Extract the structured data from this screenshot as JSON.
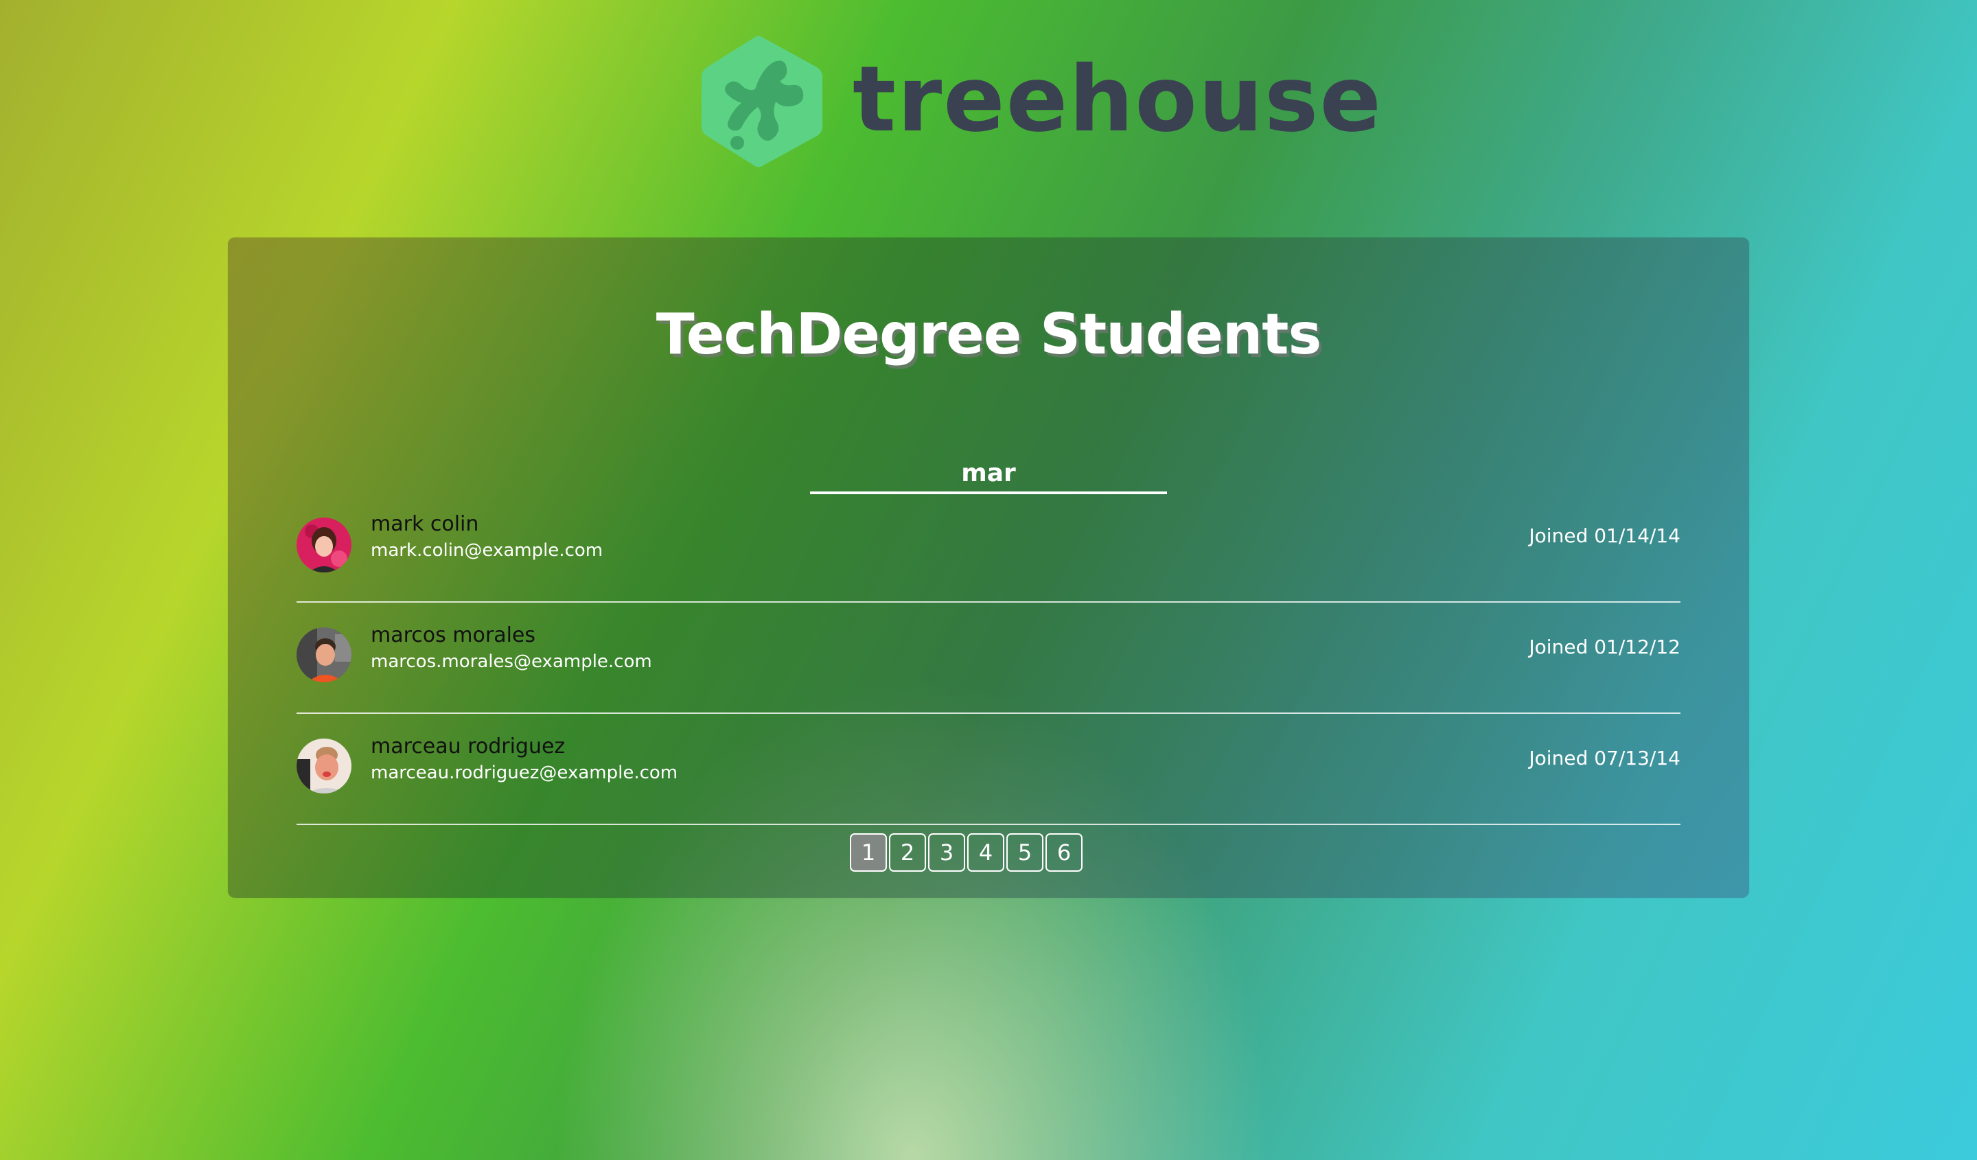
{
  "brand": {
    "logo_icon": "treehouse-logo-icon",
    "wordmark": "treehouse"
  },
  "page": {
    "title": "TechDegree Students"
  },
  "search": {
    "value": "mar",
    "placeholder": ""
  },
  "students": [
    {
      "name": "mark colin",
      "email": "mark.colin@example.com",
      "joined": "Joined 01/14/14",
      "avatar_colors": [
        "#d8205e",
        "#f6c5b0",
        "#5a2a20"
      ]
    },
    {
      "name": "marcos morales",
      "email": "marcos.morales@example.com",
      "joined": "Joined 01/12/12",
      "avatar_colors": [
        "#6a6a6a",
        "#e8a888",
        "#ee5522"
      ]
    },
    {
      "name": "marceau rodriguez",
      "email": "marceau.rodriguez@example.com",
      "joined": "Joined 07/13/14",
      "avatar_colors": [
        "#f1e6de",
        "#e99a80",
        "#222222"
      ]
    }
  ],
  "pagination": {
    "pages": [
      "1",
      "2",
      "3",
      "4",
      "5",
      "6"
    ],
    "active_page": "1"
  },
  "colors": {
    "logo_green": "#5cd384",
    "wordmark": "#3a4150",
    "text_white": "#ffffff",
    "active_page_bg": "#878787"
  }
}
